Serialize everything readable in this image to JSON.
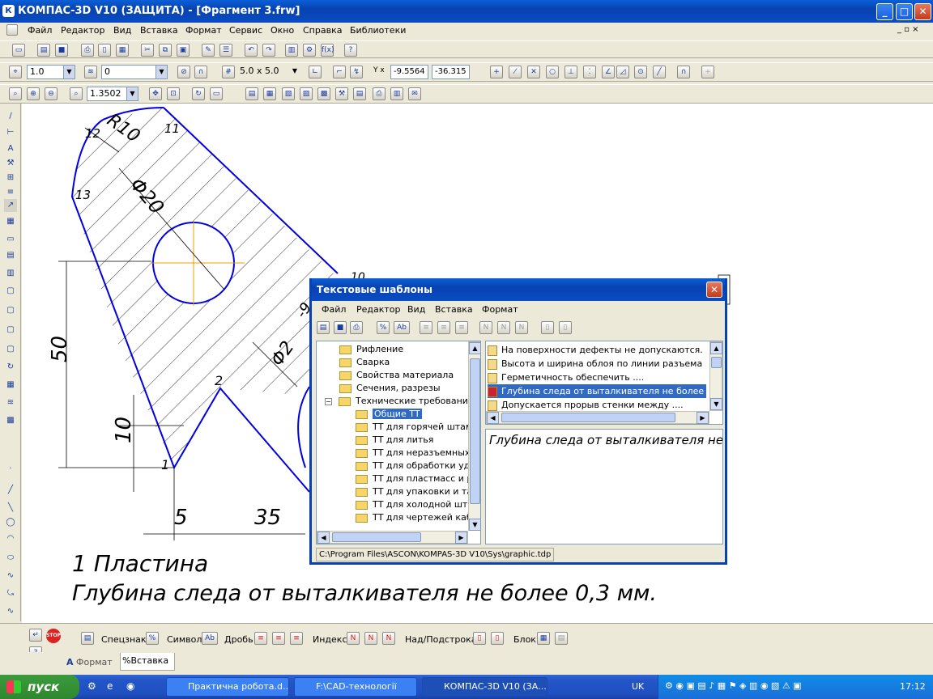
{
  "window": {
    "title": "КОМПАС-3D V10 (ЗАЩИТА) - [Фрагмент 3.frw]",
    "app_icon_letter": "К",
    "minimize": "_",
    "maximize": "□",
    "close": "✕",
    "mdi_controls": "_ ▫ ×"
  },
  "menu": [
    "Файл",
    "Редактор",
    "Вид",
    "Вставка",
    "Формат",
    "Сервис",
    "Окно",
    "Справка",
    "Библиотеки"
  ],
  "toolbar2": {
    "step_value": "1.0",
    "layer_value": "0",
    "grid_value": "5.0 x 5.0",
    "x_coord": "-9.5564",
    "y_coord": "-36.315"
  },
  "toolbar3": {
    "zoom_value": "1.3502"
  },
  "drawing": {
    "label_r10": "R10",
    "label_d20": "Φ20",
    "label_50": "50",
    "label_10": "10",
    "label_5": "5",
    "label_35": "35",
    "label_d2": "Φ2",
    "label_9": "-9",
    "pt_1": "1",
    "pt_2": "2",
    "pt_11": "11",
    "pt_12": "12",
    "pt_13": "13",
    "pt_10": "10",
    "text_line1": "1 Пластина",
    "text_line2": "Глубина следа от выталкивателя не более 0,3 мм."
  },
  "dialog": {
    "title": "Текстовые шаблоны",
    "menu": [
      "Файл",
      "Редактор",
      "Вид",
      "Вставка",
      "Формат"
    ],
    "tree": [
      "Рифление",
      "Сварка",
      "Свойства материала",
      "Сечения, разрезы",
      "Технические требования",
      "Общие ТТ",
      "ТТ для горячей штамп",
      "ТТ для литья",
      "ТТ для неразъемных с",
      "ТТ для обработки удал",
      "ТТ для пластмасс и ре",
      "ТТ для упаковки и тар",
      "ТТ для холодной штам",
      "ТТ для чертежей кабе"
    ],
    "list": [
      "На поверхности дефекты не допускаются.",
      "Высота и ширина облоя по линии разъема ....",
      "Герметичность обеспечить ....",
      "Глубина следа от выталкивателя не более ....",
      "Допускается прорыв стенки между ...."
    ],
    "selected_index": 3,
    "preview": "Глубина следа от выталкивателя не более",
    "path": "C:\\Program Files\\ASCON\\KOMPAS-3D V10\\Sys\\graphic.tdp"
  },
  "text_panel": {
    "specznak": "Спецзнак",
    "symbol": "Символ",
    "drob": "Дробь",
    "index": "Индекс",
    "nadpodstroka": "Над/Подстрока",
    "blok": "Блок",
    "stop": "STOP",
    "tab_format": "Формат",
    "tab_vstavka": "Вставка"
  },
  "taskbar": {
    "start": "пуск",
    "tasks": [
      "Практична робота.d...",
      "F:\\CAD-технології",
      "КОМПАС-3D V10 (ЗА..."
    ],
    "lang": "UK",
    "time": "17:12"
  },
  "colors": {
    "xp_blue": "#0842b0",
    "drawing_blue": "#0000e0",
    "axis_orange": "#e8a000",
    "selection": "#316ac5"
  }
}
